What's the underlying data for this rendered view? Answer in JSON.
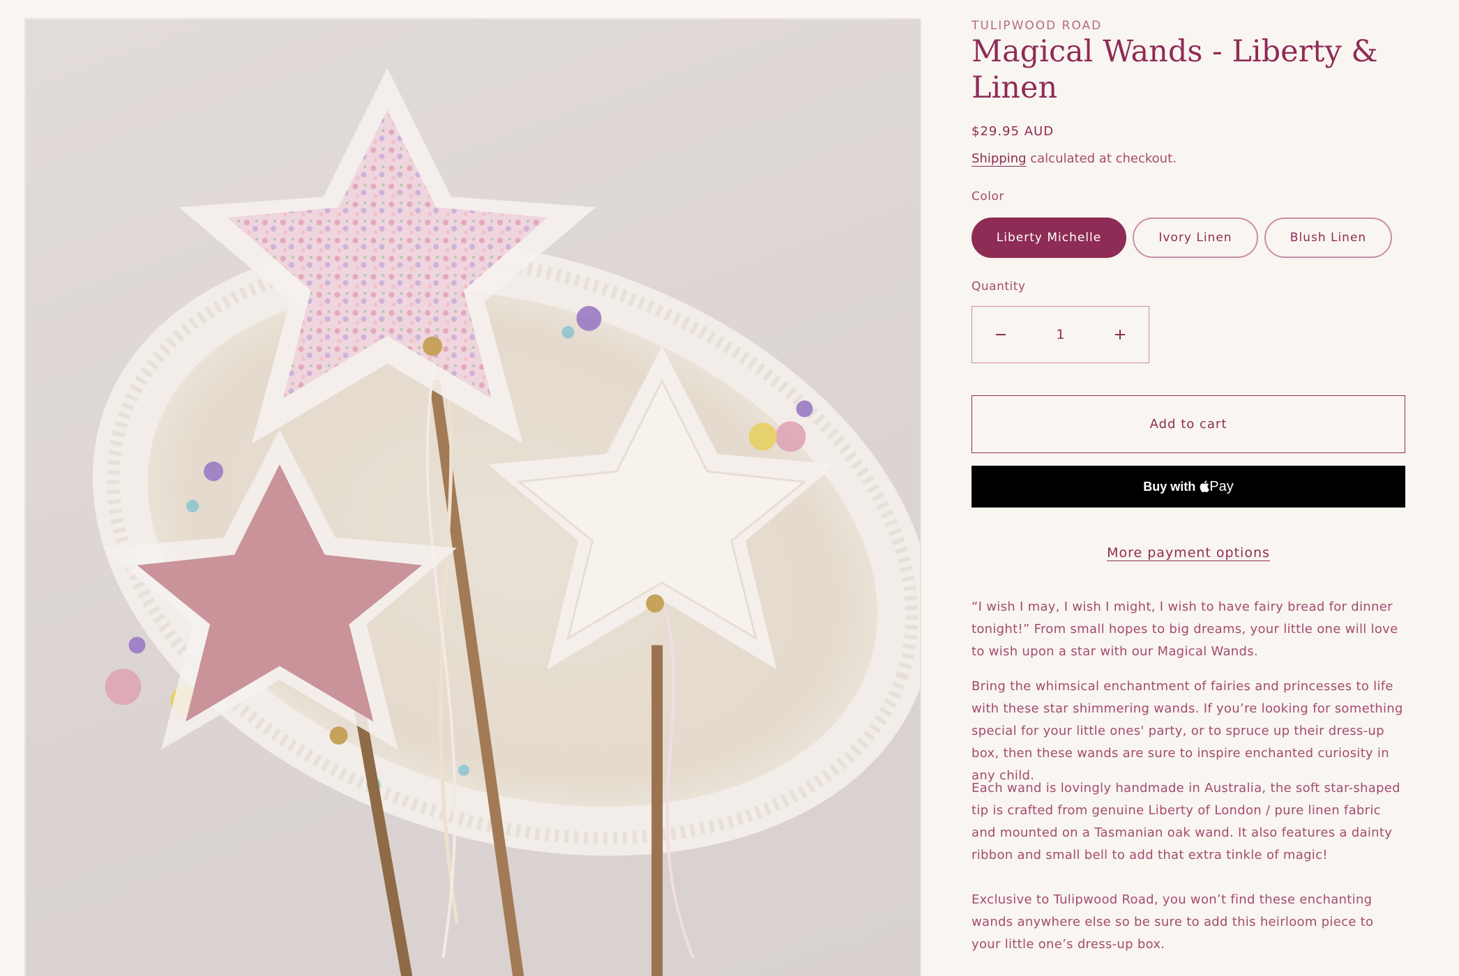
{
  "product": {
    "vendor": "TULIPWOOD ROAD",
    "title": "Magical Wands - Liberty & Linen",
    "price": "$29.95 AUD",
    "shipping_link": "Shipping",
    "shipping_rest": " calculated at checkout."
  },
  "color": {
    "label": "Color",
    "options": [
      "Liberty Michelle",
      "Ivory Linen",
      "Blush Linen"
    ],
    "selected": "Liberty Michelle"
  },
  "quantity": {
    "label": "Quantity",
    "value": "1",
    "decrease_icon": "minus-icon",
    "increase_icon": "plus-icon"
  },
  "buttons": {
    "add_to_cart": "Add to cart",
    "buy_with": "Buy with",
    "apple_pay": "Pay",
    "more_options": "More payment options"
  },
  "description": [
    "“I wish I may, I wish I might, I wish to have fairy bread for dinner tonight!” From small hopes to big dreams, your little one will love to wish upon a star with our Magical Wands.",
    "Bring the whimsical enchantment of fairies and princesses to life with these star shimmering wands. If you’re looking for something special for your little ones' party, or to spruce up their dress-up box, then these wands are sure to inspire enchanted curiosity in any child.",
    " Each wand is lovingly handmade in Australia, the soft star-shaped tip is crafted from genuine Liberty of London / pure linen fabric and mounted on a Tasmanian oak wand. It also features a dainty ribbon and small bell to add that extra tinkle of magic!",
    "Exclusive to Tulipwood Road, you won’t find these enchanting wands anywhere else so be sure to add this heirloom piece to your little one’s dress-up box."
  ],
  "colors": {
    "accent": "#8e2c55",
    "text_muted": "#a24c70",
    "background": "#f9f5f1"
  }
}
